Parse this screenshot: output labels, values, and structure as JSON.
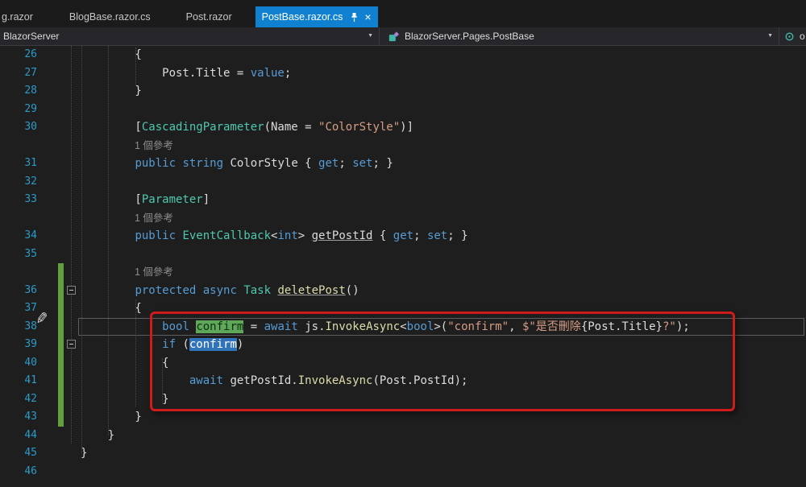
{
  "tabs": {
    "clipped_tab_label": "g.razor",
    "items": [
      {
        "label": "BlogBase.razor.cs",
        "active": false
      },
      {
        "label": "Post.razor",
        "active": false
      },
      {
        "label": "PostBase.razor.cs",
        "active": true
      }
    ]
  },
  "navbar": {
    "project_dropdown": "BlazorServer",
    "type_dropdown": "BlazorServer.Pages.PostBase",
    "member_dropdown_partial": "o"
  },
  "icons": {
    "close": "×",
    "dropdown_arrow": "▼",
    "pen": "✎"
  },
  "colors": {
    "active_tab": "#1080D0",
    "keyword": "#569CD6",
    "type": "#4EC9B0",
    "string": "#D69D85",
    "method": "#DCDCAA",
    "line_number": "#2B9BC9",
    "change_bar": "#619F3C",
    "codelens_text": "#8C8C8C",
    "annotation_red": "#CE1B1B",
    "reference_highlight_green": "#5FA85A",
    "selection_highlight_blue": "#3173B9"
  },
  "editor": {
    "codelens_label": "1 個參考",
    "rows": [
      {
        "ln": "26",
        "tokens": [
          [
            "p",
            "        {"
          ]
        ]
      },
      {
        "ln": "27",
        "tokens": [
          [
            "p",
            "            Post.Title = "
          ],
          [
            "k",
            "value"
          ],
          [
            "p",
            ";"
          ]
        ]
      },
      {
        "ln": "28",
        "tokens": [
          [
            "p",
            "        }"
          ]
        ]
      },
      {
        "ln": "29",
        "tokens": []
      },
      {
        "ln": "30",
        "tokens": [
          [
            "p",
            "        ["
          ],
          [
            "t",
            "CascadingParameter"
          ],
          [
            "p",
            "(Name = "
          ],
          [
            "s",
            "\"ColorStyle\""
          ],
          [
            "p",
            ")]"
          ]
        ]
      },
      {
        "ln": "",
        "lens": true,
        "tokens": [
          [
            "c",
            "1 個參考"
          ]
        ]
      },
      {
        "ln": "31",
        "tokens": [
          [
            "p",
            "        "
          ],
          [
            "k",
            "public"
          ],
          [
            "p",
            " "
          ],
          [
            "k",
            "string"
          ],
          [
            "p",
            " ColorStyle { "
          ],
          [
            "k",
            "get"
          ],
          [
            "p",
            "; "
          ],
          [
            "k",
            "set"
          ],
          [
            "p",
            "; }"
          ]
        ]
      },
      {
        "ln": "32",
        "tokens": []
      },
      {
        "ln": "33",
        "tokens": [
          [
            "p",
            "        ["
          ],
          [
            "t",
            "Parameter"
          ],
          [
            "p",
            "]"
          ]
        ]
      },
      {
        "ln": "",
        "lens": true,
        "tokens": [
          [
            "c",
            "1 個參考"
          ]
        ]
      },
      {
        "ln": "34",
        "tokens": [
          [
            "p",
            "        "
          ],
          [
            "k",
            "public"
          ],
          [
            "p",
            " "
          ],
          [
            "t",
            "EventCallback"
          ],
          [
            "p",
            "<"
          ],
          [
            "k",
            "int"
          ],
          [
            "p",
            "> "
          ],
          [
            "pu",
            "getPostId"
          ],
          [
            "p",
            " { "
          ],
          [
            "k",
            "get"
          ],
          [
            "p",
            "; "
          ],
          [
            "k",
            "set"
          ],
          [
            "p",
            "; }"
          ]
        ]
      },
      {
        "ln": "35",
        "tokens": []
      },
      {
        "ln": "",
        "lens": true,
        "changebar": true,
        "tokens": [
          [
            "c",
            "1 個參考"
          ]
        ]
      },
      {
        "ln": "36",
        "changebar": true,
        "fold": true,
        "tokens": [
          [
            "p",
            "        "
          ],
          [
            "k",
            "protected"
          ],
          [
            "p",
            " "
          ],
          [
            "k",
            "async"
          ],
          [
            "p",
            " "
          ],
          [
            "t",
            "Task"
          ],
          [
            "p",
            " "
          ],
          [
            "mu",
            "deletePost"
          ],
          [
            "p",
            "()"
          ]
        ]
      },
      {
        "ln": "37",
        "changebar": true,
        "tokens": [
          [
            "p",
            "        {"
          ]
        ]
      },
      {
        "ln": "38",
        "changebar": true,
        "current": true,
        "tokens": [
          [
            "p",
            "            "
          ],
          [
            "k",
            "bool"
          ],
          [
            "p",
            " "
          ],
          [
            "g",
            "confirm"
          ],
          [
            "p",
            " = "
          ],
          [
            "k",
            "await"
          ],
          [
            "p",
            " js."
          ],
          [
            "m",
            "InvokeAsync"
          ],
          [
            "p",
            "<"
          ],
          [
            "k",
            "bool"
          ],
          [
            "p",
            ">("
          ],
          [
            "s",
            "\"confirm\""
          ],
          [
            "p",
            ", "
          ],
          [
            "s",
            "$\"是否刪除"
          ],
          [
            "p",
            "{Post.Title}"
          ],
          [
            "s",
            "?\""
          ],
          [
            "p",
            ");"
          ]
        ]
      },
      {
        "ln": "39",
        "changebar": true,
        "fold": true,
        "tokens": [
          [
            "p",
            "            "
          ],
          [
            "k",
            "if"
          ],
          [
            "p",
            " ("
          ],
          [
            "b",
            "confirm"
          ],
          [
            "p",
            ")"
          ]
        ]
      },
      {
        "ln": "40",
        "changebar": true,
        "tokens": [
          [
            "p",
            "            {"
          ]
        ]
      },
      {
        "ln": "41",
        "changebar": true,
        "tokens": [
          [
            "p",
            "                "
          ],
          [
            "k",
            "await"
          ],
          [
            "p",
            " getPostId."
          ],
          [
            "m",
            "InvokeAsync"
          ],
          [
            "p",
            "(Post.PostId);"
          ]
        ]
      },
      {
        "ln": "42",
        "changebar": true,
        "tokens": [
          [
            "p",
            "            }"
          ]
        ]
      },
      {
        "ln": "43",
        "changebar": true,
        "tokens": [
          [
            "p",
            "        }"
          ]
        ]
      },
      {
        "ln": "44",
        "tokens": [
          [
            "p",
            "    }"
          ]
        ]
      },
      {
        "ln": "45",
        "tokens": [
          [
            "p",
            "}"
          ]
        ]
      },
      {
        "ln": "46",
        "tokens": []
      }
    ]
  }
}
